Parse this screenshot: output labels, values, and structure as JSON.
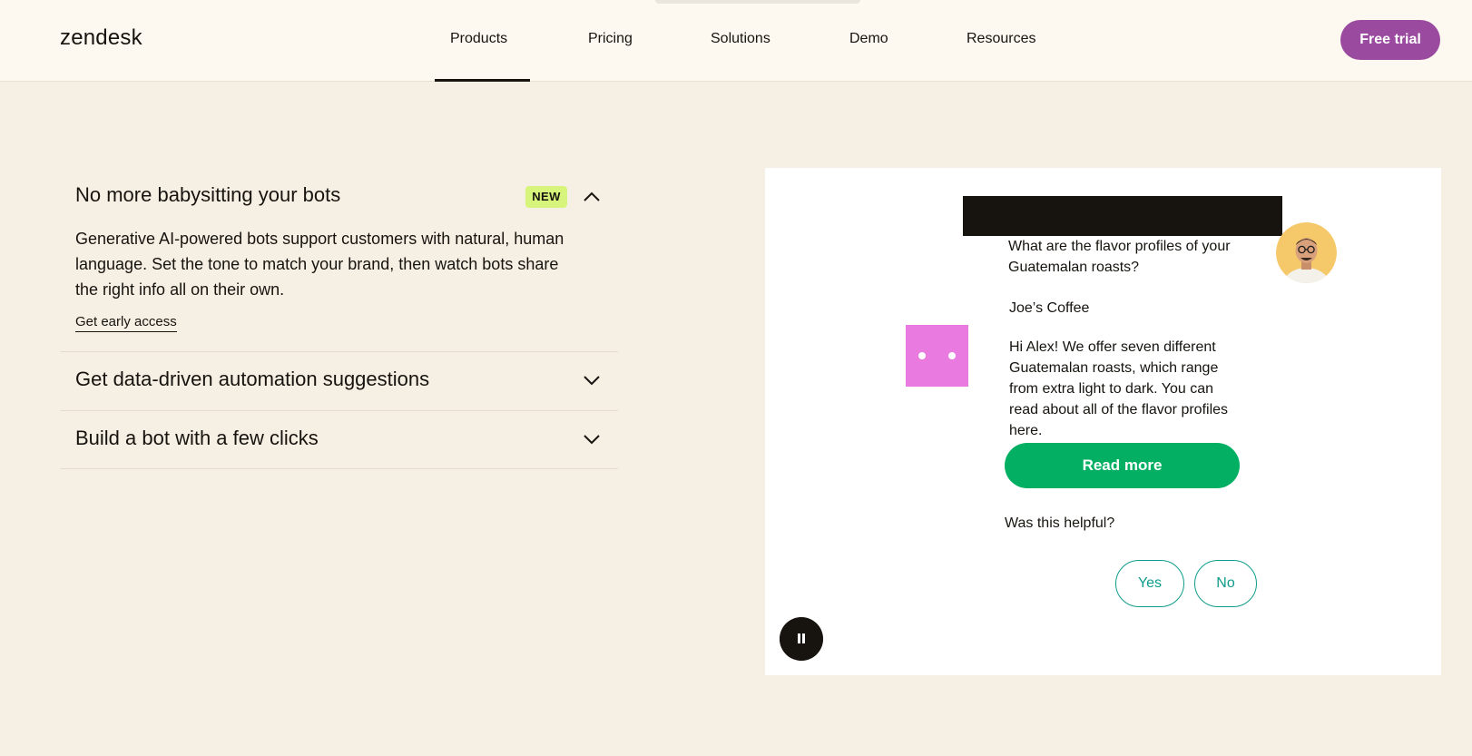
{
  "header": {
    "logo": "zendesk",
    "nav": [
      "Products",
      "Pricing",
      "Solutions",
      "Demo",
      "Resources"
    ],
    "active_nav": "Products",
    "cta_label": "Free trial",
    "cta_color": "#9b4b9f"
  },
  "accordion": {
    "items": [
      {
        "title": "No more babysitting your bots",
        "badge": "NEW",
        "expanded": true,
        "body": "Generative AI-powered bots support customers with natural, human language. Set the tone to match your brand, then watch bots share the right info all on their own.",
        "link": "Get early access"
      },
      {
        "title": "Get data-driven automation suggestions",
        "expanded": false
      },
      {
        "title": "Build a bot with a few clicks",
        "expanded": false
      }
    ]
  },
  "demo": {
    "user_message": "What are the flavor profiles of your Guatemalan roasts?",
    "bot_name": "Joe’s Coffee",
    "bot_message": "Hi Alex! We offer seven different Guatemalan roasts, which range from extra light to dark. You can read about all of the flavor profiles here.",
    "read_more_label": "Read more",
    "helpful_prompt": "Was this helpful?",
    "yes_label": "Yes",
    "no_label": "No",
    "accent_green": "#03b063",
    "accent_teal": "#0d9c8a",
    "bot_avatar_color": "#e87ae0"
  }
}
